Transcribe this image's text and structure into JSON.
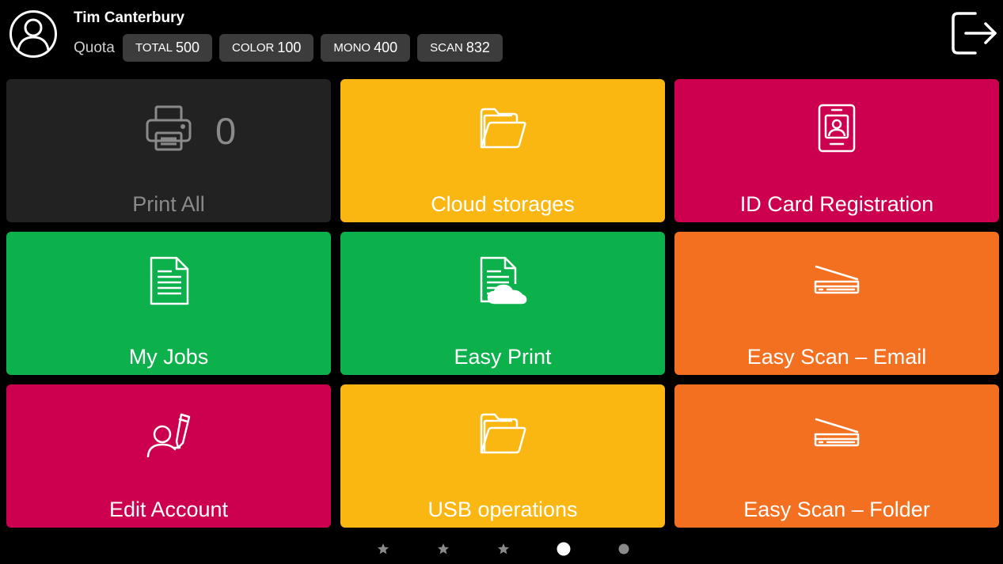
{
  "header": {
    "user_name": "Tim Canterbury",
    "quota_label": "Quota",
    "quota": [
      {
        "key": "TOTAL",
        "value": "500"
      },
      {
        "key": "COLOR",
        "value": "100"
      },
      {
        "key": "MONO",
        "value": "400"
      },
      {
        "key": "SCAN",
        "value": "832"
      }
    ],
    "avatar_icon": "user-avatar-icon",
    "logout_icon": "logout-icon"
  },
  "tiles": [
    {
      "label": "Print All",
      "count": "0",
      "icon": "printer-icon",
      "color": "#222222"
    },
    {
      "label": "Cloud storages",
      "icon": "folder-icon",
      "color": "#fbb711"
    },
    {
      "label": "ID Card Registration",
      "icon": "id-badge-icon",
      "color": "#cd004f"
    },
    {
      "label": "My Jobs",
      "icon": "document-icon",
      "color": "#0db14b"
    },
    {
      "label": "Easy Print",
      "icon": "document-cloud-icon",
      "color": "#0db14b"
    },
    {
      "label": "Easy Scan – Email",
      "icon": "scanner-icon",
      "color": "#f37021"
    },
    {
      "label": "Edit Account",
      "icon": "user-edit-icon",
      "color": "#cd004f"
    },
    {
      "label": "USB operations",
      "icon": "folder-icon",
      "color": "#fbb711"
    },
    {
      "label": "Easy Scan – Folder",
      "icon": "scanner-icon",
      "color": "#f37021"
    }
  ],
  "pager": {
    "pages": 5,
    "current": 4,
    "dots": [
      "star-icon",
      "star-icon",
      "star-icon",
      "dot-active-icon",
      "dot-icon"
    ]
  },
  "colors": {
    "background": "#000000",
    "badge": "#3c3c3c",
    "print_all_text": "#8a8a8a"
  }
}
